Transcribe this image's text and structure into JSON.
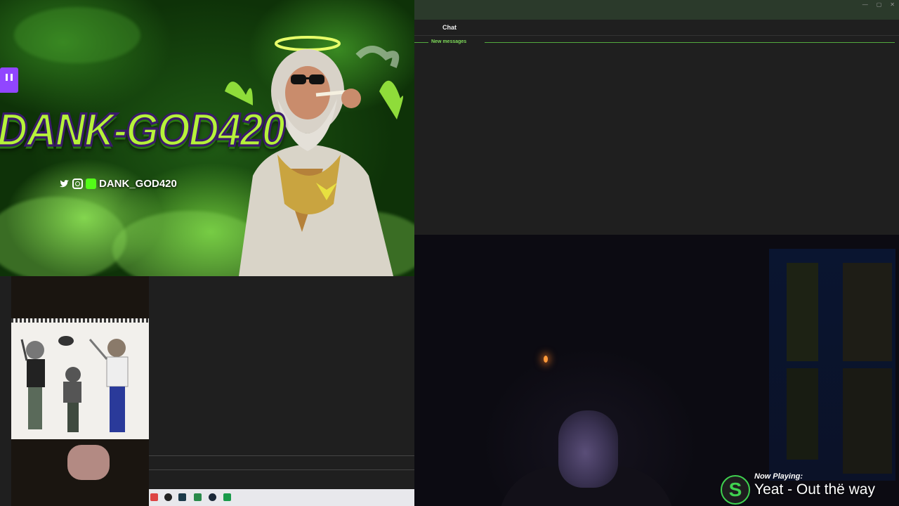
{
  "banner": {
    "streamer_name": "DANK-GOD420",
    "social_handle": "DANK_GOD420",
    "icons": [
      "twitch-icon",
      "twitter-icon",
      "instagram-icon",
      "kick-icon"
    ]
  },
  "chat": {
    "title": "Chat",
    "new_messages_label": "New messages"
  },
  "now_playing": {
    "label": "Now Playing:",
    "track": "Yeat - Out thë way"
  },
  "colors": {
    "accent_green": "#53a93f",
    "twitch_purple": "#9146ff",
    "spotify_green": "#3fd14f"
  }
}
